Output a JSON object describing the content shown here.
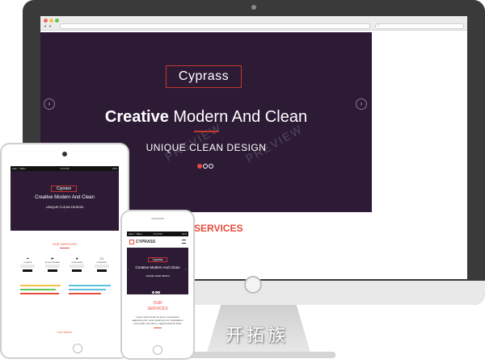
{
  "watermark": "开拓族",
  "desktop": {
    "hero": {
      "brand": "Cyprass",
      "title_bold": "Creative",
      "title_rest": " Modern And Clean",
      "tagline": "UNIQUE CLEAN DESIGN",
      "preview_mark": "PREVIEW",
      "prev_arrow": "‹",
      "next_arrow": "›"
    },
    "services_heading": "SERVICES",
    "accent_color": "#e74c3c",
    "hero_bg": "#2d1b36"
  },
  "tablet": {
    "status": {
      "carrier": "●●●○○ BELL",
      "time": "4:21 PM",
      "battery": "22%"
    },
    "hero": {
      "brand": "Cyprass",
      "title": "Creative Modern And Clean",
      "tagline": "UNIQUE CLEAN DESIGN",
      "sub": "◦◦◦"
    },
    "services_heading": "OUR SERVICES",
    "service_items": [
      {
        "icon": "location-icon",
        "glyph": "⌖",
        "label": "LOCATION"
      },
      {
        "icon": "rocket-icon",
        "glyph": "➤",
        "label": "ROCKET PROMISE"
      },
      {
        "icon": "globe-icon",
        "glyph": "●",
        "label": "IN THE SERVE"
      },
      {
        "icon": "monitor-icon",
        "glyph": "▭",
        "label": "CONSISTENT"
      }
    ],
    "footer_heading": "OUR WORKS"
  },
  "phone": {
    "status": {
      "carrier": "●●●○○ BELL",
      "time": "4:21 PM",
      "battery": "22%"
    },
    "logo_text": "CYPRASS",
    "hero": {
      "brand": "Cypress",
      "title": "Creative Modern And Clean",
      "tagline": "UNIQUE CLEAN DESIGN"
    },
    "services_line1": "OUR",
    "services_line2": "SERVICES",
    "body": "Lorem ipsum dolor sit amet, consectetur adipisicing elit. Iusto possimus non voluptatibus enim quam nisi earum, eligendi deleniti dicta."
  }
}
